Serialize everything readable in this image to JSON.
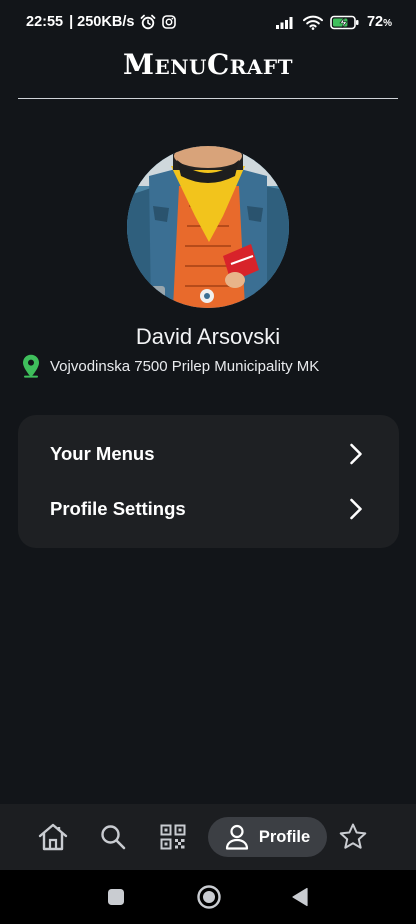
{
  "status_bar": {
    "time": "22:55",
    "net_speed": "| 250KB/s",
    "battery_percent": "72",
    "battery_unit": "%",
    "battery_level": 0.72,
    "icons": [
      "alarm-icon",
      "instagram-icon",
      "signal-icon",
      "wifi-icon",
      "battery-charging-icon"
    ]
  },
  "header": {
    "title": "MenuCraft"
  },
  "profile": {
    "name": "David Arsovski",
    "location": "Vojvodinska 7500 Prilep Municipality MK",
    "location_icon": "map-pin-icon",
    "location_icon_color": "#3fbf5c"
  },
  "menu": {
    "items": [
      {
        "label": "Your Menus",
        "icon": "chevron-right-icon"
      },
      {
        "label": "Profile Settings",
        "icon": "chevron-right-icon"
      }
    ]
  },
  "bottom_nav": {
    "items": [
      {
        "icon": "home-icon"
      },
      {
        "icon": "search-icon"
      },
      {
        "icon": "qr-code-icon"
      },
      {
        "icon": "user-icon",
        "label": "Profile",
        "active": true
      },
      {
        "icon": "star-icon"
      }
    ]
  },
  "system_nav": {
    "icons": [
      "recents-icon",
      "home-circle-icon",
      "back-icon"
    ]
  },
  "colors": {
    "background": "#121519",
    "card": "#1e2023",
    "nav_bar": "#1c1e21",
    "active_pill": "#3c3f44",
    "accent_green": "#3fbf5c"
  }
}
